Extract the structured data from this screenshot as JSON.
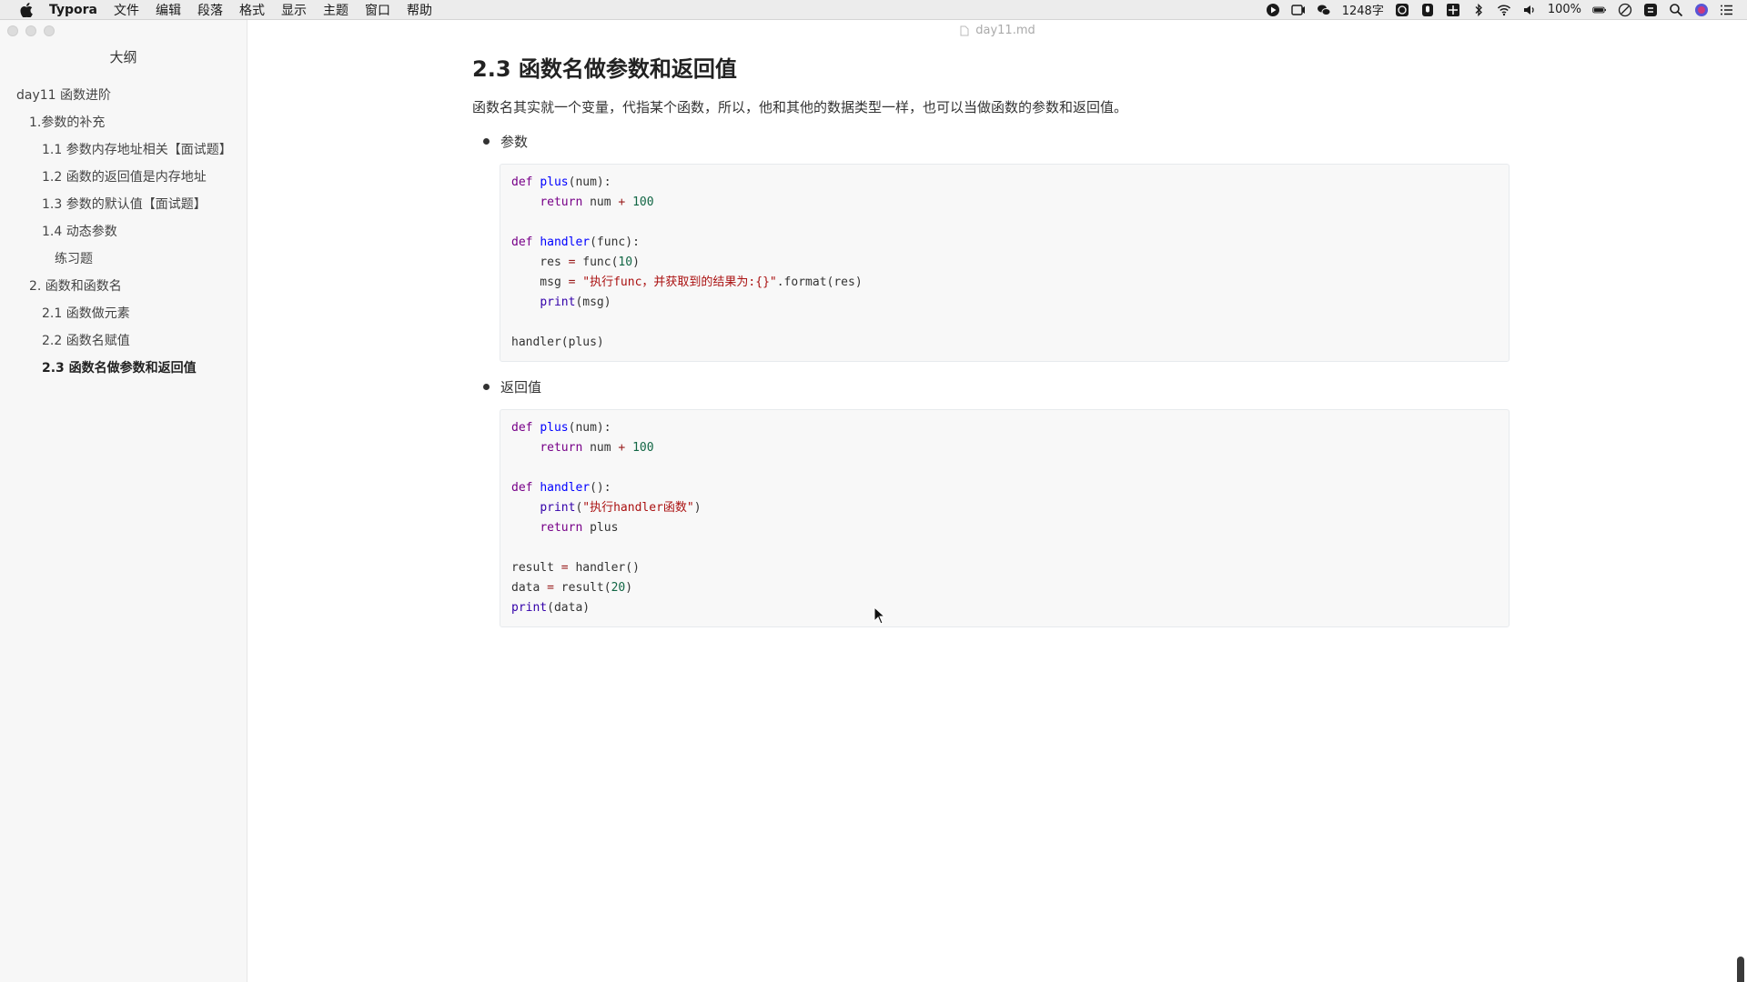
{
  "menubar": {
    "app_name": "Typora",
    "items": [
      "文件",
      "编辑",
      "段落",
      "格式",
      "显示",
      "主题",
      "窗口",
      "帮助"
    ],
    "word_count": "1248字",
    "battery": "100%"
  },
  "sidebar": {
    "title": "大纲",
    "outline": [
      {
        "label": "day11 函数进阶",
        "level": 1,
        "active": false
      },
      {
        "label": "1.参数的补充",
        "level": 2,
        "active": false
      },
      {
        "label": "1.1 参数内存地址相关【面试题】",
        "level": 3,
        "active": false
      },
      {
        "label": "1.2 函数的返回值是内存地址",
        "level": 3,
        "active": false
      },
      {
        "label": "1.3 参数的默认值【面试题】",
        "level": 3,
        "active": false
      },
      {
        "label": "1.4 动态参数",
        "level": 3,
        "active": false
      },
      {
        "label": "练习题",
        "level": 4,
        "active": false
      },
      {
        "label": "2. 函数和函数名",
        "level": 2,
        "active": false
      },
      {
        "label": "2.1 函数做元素",
        "level": 3,
        "active": false
      },
      {
        "label": "2.2 函数名赋值",
        "level": 3,
        "active": false
      },
      {
        "label": "2.3 函数名做参数和返回值",
        "level": 3,
        "active": true
      }
    ]
  },
  "document": {
    "filename": "day11.md",
    "heading": "2.3 函数名做参数和返回值",
    "paragraph": "函数名其实就一个变量，代指某个函数，所以，他和其他的数据类型一样，也可以当做函数的参数和返回值。",
    "bullet_1": "参数",
    "bullet_2": "返回值"
  },
  "colors": {
    "keyword": "#770088",
    "function_name": "#0000ff",
    "builtin": "#3300aa",
    "number": "#116644",
    "string": "#aa1111",
    "code_bg": "#f8f8f8",
    "sidebar_bg": "#f7f7f7"
  }
}
